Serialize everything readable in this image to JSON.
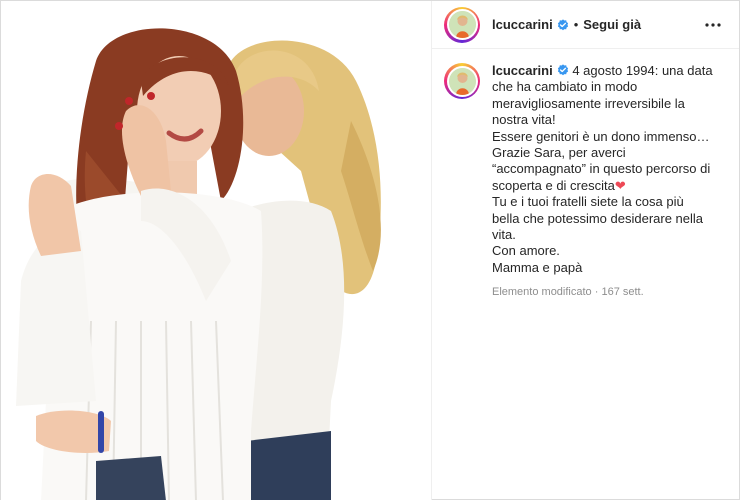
{
  "post": {
    "username": "lcuccarini",
    "follow_label": "Segui già",
    "separator": "•",
    "caption": {
      "first_line_text": "4 agosto 1994: una data",
      "lines": [
        "che ha cambiato in modo",
        "meravigliosamente irreversibile la",
        "nostra vita!",
        "Essere genitori è un dono immenso…",
        "Grazie Sara, per averci",
        "“accompagnato” in questo percorso di",
        "scoperta e di crescita",
        "Tu e i tuoi fratelli siete la cosa più",
        "bella che potessimo desiderare nella",
        "vita.",
        "Con amore.",
        "Mamma e papà"
      ],
      "heart_emoji": "❤"
    },
    "edited_label": "Elemento modificato",
    "meta_separator": "·",
    "time_ago": "167 sett."
  },
  "icons": {
    "verified": "verified-badge-icon",
    "more": "more-options-icon"
  },
  "colors": {
    "verified_blue": "#3897f0",
    "text": "#262626",
    "secondary_text": "#8e8e8e",
    "heart": "#ed4956",
    "border": "#dbdbdb"
  }
}
